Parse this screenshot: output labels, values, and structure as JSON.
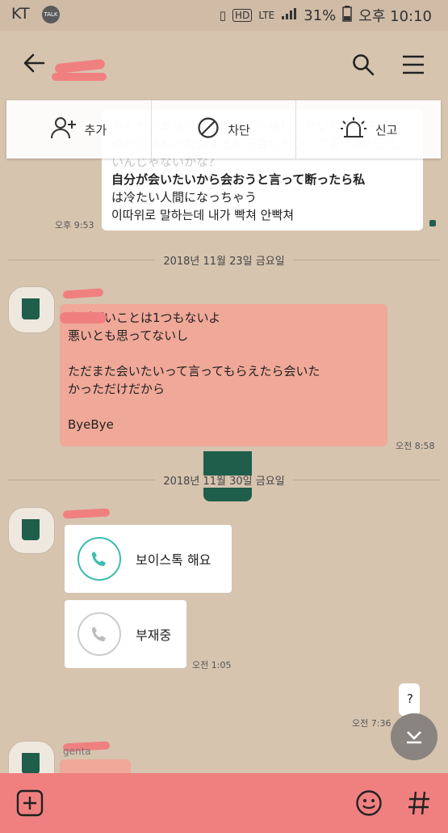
{
  "status": {
    "carrier": "KT",
    "talk": "TALK",
    "battery": "31%",
    "time": "오후 10:10",
    "net": "LTE"
  },
  "menu": {
    "add": "추가",
    "block": "차단",
    "report": "신고"
  },
  "msg1": {
    "ghost": "あんたが本当に私と本気で一緒にいたいなら、そんなのがこめんか努力するから会いたいって言うのが正しいんじゃないかな？",
    "lines": [
      "自分が会いたいから会おうと言って断ったら私",
      "は冷たい人間になっちゃう",
      "이따위로 말하는데 내가 빡쳐 안빡쳐"
    ],
    "time": "오후 9:53"
  },
  "date1": "2018년 11월 23일 금요일",
  "msg2": {
    "lines": [
      "私が悪いことは1つもないよ",
      "悪いとも思ってないし",
      "",
      "ただまた会いたいって言ってもらえたら会いた",
      "かっただけだから",
      "",
      "ByeBye"
    ],
    "time": "오전 8:58"
  },
  "date2": "2018년 11월 30일 금요일",
  "call1": {
    "label": "보이스톡 해요"
  },
  "call2": {
    "label": "부재중",
    "time": "오전 1:05"
  },
  "msg3": {
    "text": "?",
    "time": "오전 7:36"
  },
  "peek_name": "genta",
  "colors": {
    "bg": "#d6c4af",
    "accent": "#f08080",
    "voice": "#3bbcb0"
  }
}
